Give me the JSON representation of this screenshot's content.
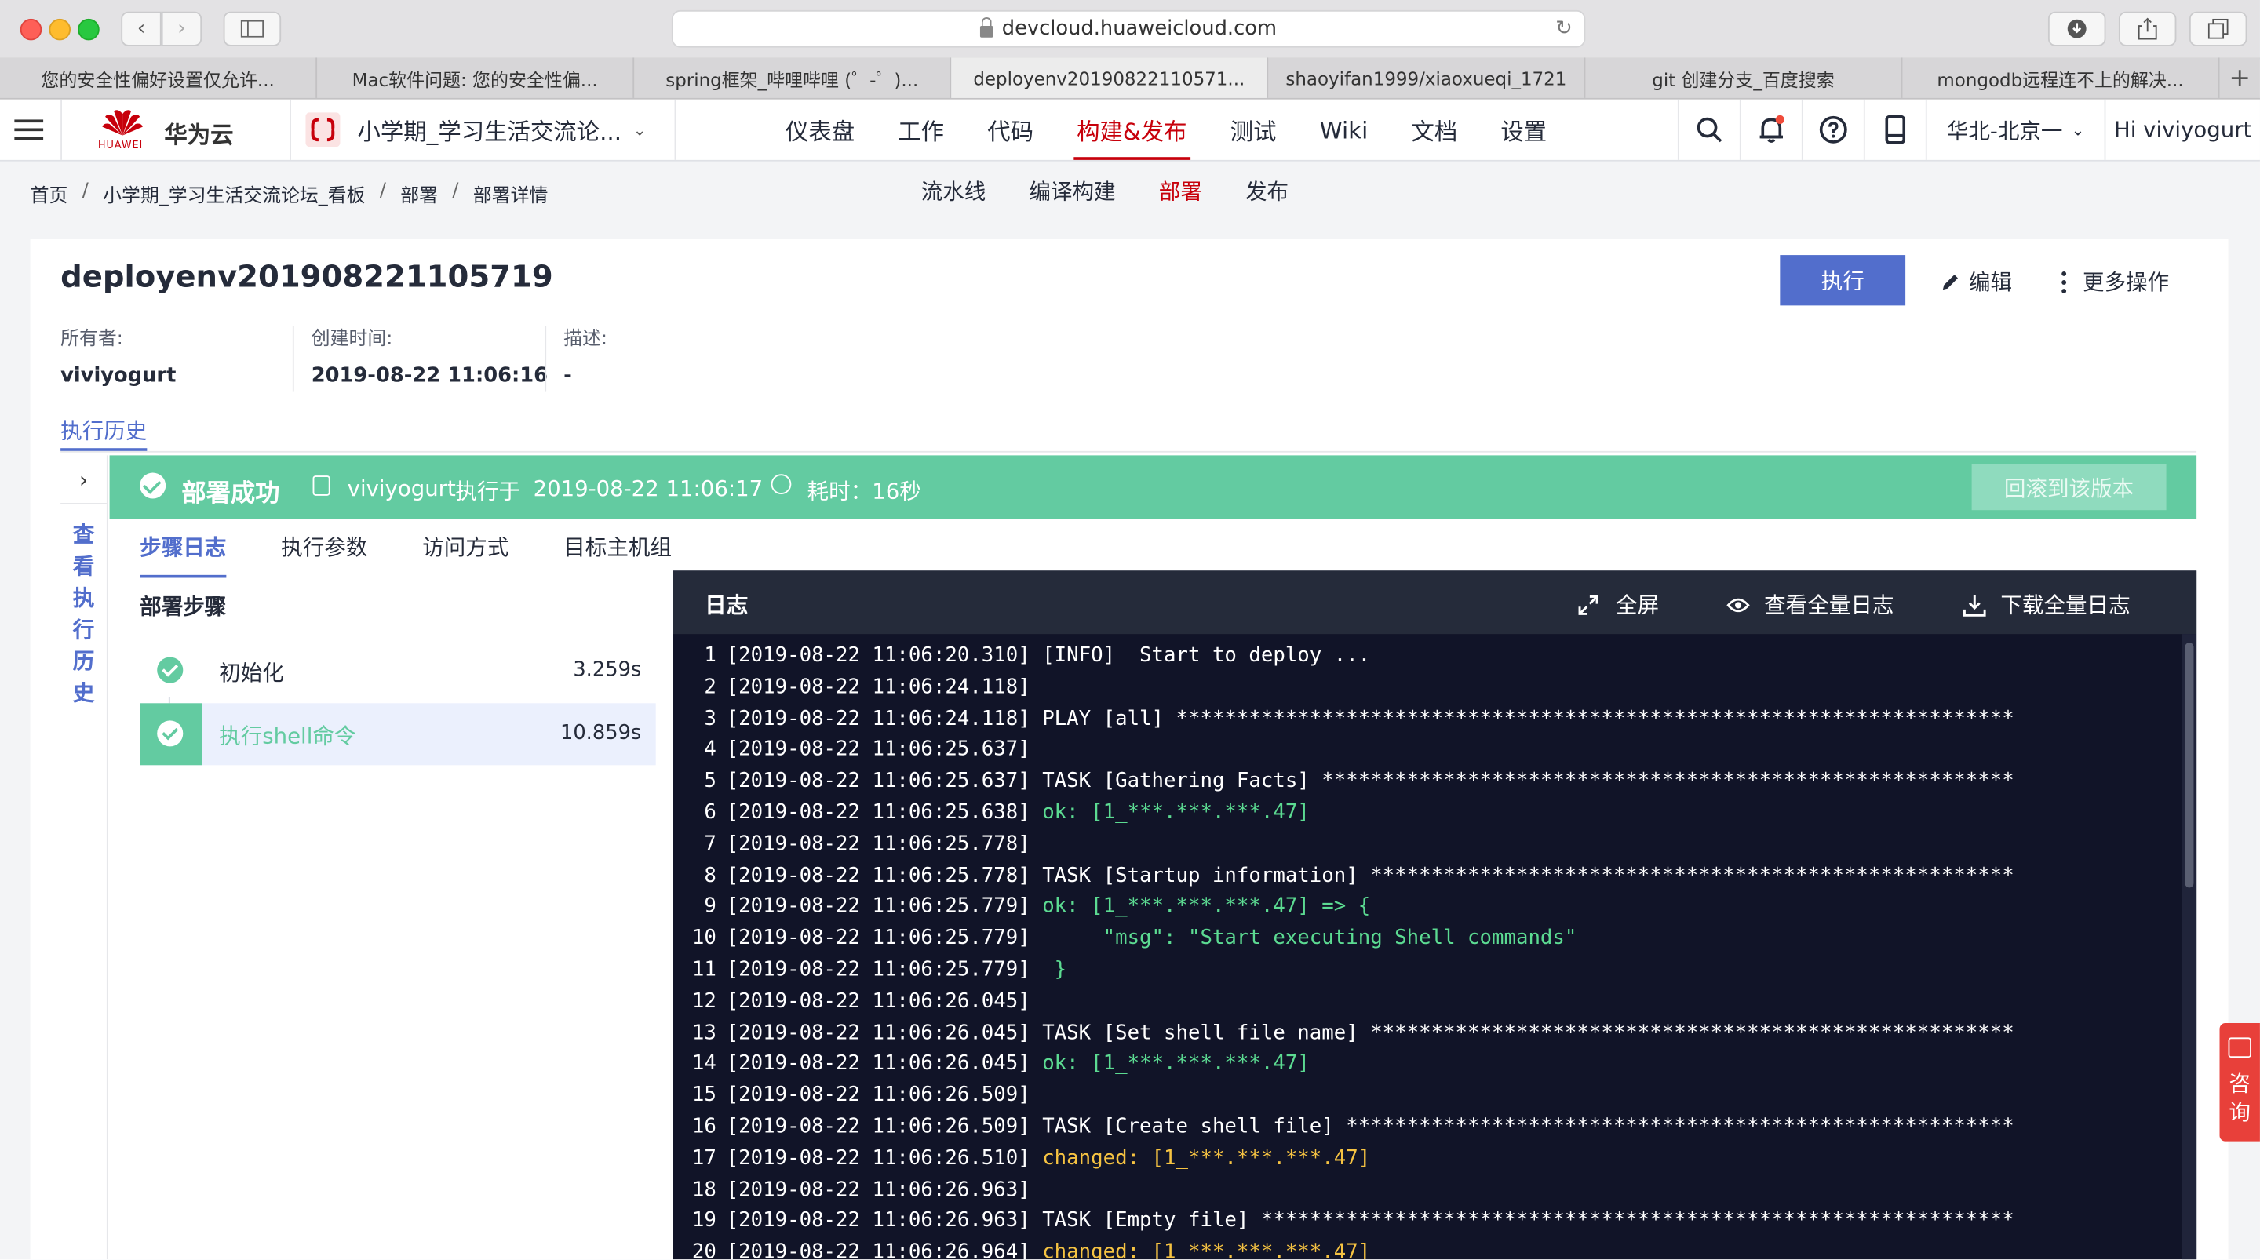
{
  "browser": {
    "url": "devcloud.huaweicloud.com",
    "tabs": [
      "您的安全性偏好设置仅允许...",
      "Mac软件问题: 您的安全性偏...",
      "spring框架_哔哩哔哩 (゜-゜)...",
      "deployenv20190822110571...",
      "shaoyifan1999/xiaoxueqi_1721",
      "git 创建分支_百度搜索",
      "mongodb远程连不上的解决..."
    ]
  },
  "header": {
    "brand": "华为云",
    "brand_small": "HUAWEI",
    "project": "小学期_学习生活交流论...",
    "nav": [
      "仪表盘",
      "工作",
      "代码",
      "构建&发布",
      "测试",
      "Wiki",
      "文档",
      "设置"
    ],
    "region": "华北-北京一",
    "greeting": "Hi viviyogurt"
  },
  "breadcrumb": [
    "首页",
    "小学期_学习生活交流论坛_看板",
    "部署",
    "部署详情"
  ],
  "subnav": [
    "流水线",
    "编译构建",
    "部署",
    "发布"
  ],
  "detail": {
    "title": "deployenv201908221105719",
    "run_label": "执行",
    "edit_label": "编辑",
    "more_label": "更多操作",
    "owner_label": "所有者:",
    "owner": "viviyogurt",
    "created_label": "创建时间:",
    "created": "2019-08-22 11:06:16",
    "desc_label": "描述:",
    "desc": "-",
    "history_tab": "执行历史",
    "strip_label": "查看执行历史"
  },
  "banner": {
    "status": "部署成功",
    "user": "viviyogurt",
    "exec_label": "执行于",
    "exec_time": "2019-08-22 11:06:17",
    "duration": "耗时：16秒",
    "rollback": "回滚到该版本"
  },
  "inner_tabs": [
    "步骤日志",
    "执行参数",
    "访问方式",
    "目标主机组"
  ],
  "steps": {
    "title": "部署步骤",
    "items": [
      {
        "name": "初始化",
        "duration": "3.259s"
      },
      {
        "name": "执行shell命令",
        "duration": "10.859s"
      }
    ]
  },
  "log": {
    "title": "日志",
    "actions": {
      "fullscreen": "全屏",
      "view_all": "查看全量日志",
      "download": "下载全量日志"
    },
    "lines": [
      {
        "n": "1",
        "t": "[2019-08-22 11:06:20.310]",
        "m": " [INFO]  Start to deploy ...",
        "k": "normal"
      },
      {
        "n": "2",
        "t": "[2019-08-22 11:06:24.118]",
        "m": "",
        "k": "normal"
      },
      {
        "n": "3",
        "t": "[2019-08-22 11:06:24.118]",
        "m": " PLAY [all] *********************************************************************",
        "k": "normal"
      },
      {
        "n": "4",
        "t": "[2019-08-22 11:06:25.637]",
        "m": "",
        "k": "normal"
      },
      {
        "n": "5",
        "t": "[2019-08-22 11:06:25.637]",
        "m": " TASK [Gathering Facts] *********************************************************",
        "k": "normal"
      },
      {
        "n": "6",
        "t": "[2019-08-22 11:06:25.638]",
        "m": " ok: [1_***.***.***.47]",
        "k": "ok"
      },
      {
        "n": "7",
        "t": "[2019-08-22 11:06:25.778]",
        "m": "",
        "k": "normal"
      },
      {
        "n": "8",
        "t": "[2019-08-22 11:06:25.778]",
        "m": " TASK [Startup information] *****************************************************",
        "k": "normal"
      },
      {
        "n": "9",
        "t": "[2019-08-22 11:06:25.779]",
        "m": " ok: [1_***.***.***.47] => {",
        "k": "ok"
      },
      {
        "n": "10",
        "t": "[2019-08-22 11:06:25.779]",
        "m": "      \"msg\": \"Start executing Shell commands\"",
        "k": "ok"
      },
      {
        "n": "11",
        "t": "[2019-08-22 11:06:25.779]",
        "m": "  }",
        "k": "ok"
      },
      {
        "n": "12",
        "t": "[2019-08-22 11:06:26.045]",
        "m": "",
        "k": "normal"
      },
      {
        "n": "13",
        "t": "[2019-08-22 11:06:26.045]",
        "m": " TASK [Set shell file name] *****************************************************",
        "k": "normal"
      },
      {
        "n": "14",
        "t": "[2019-08-22 11:06:26.045]",
        "m": " ok: [1_***.***.***.47]",
        "k": "ok"
      },
      {
        "n": "15",
        "t": "[2019-08-22 11:06:26.509]",
        "m": "",
        "k": "normal"
      },
      {
        "n": "16",
        "t": "[2019-08-22 11:06:26.509]",
        "m": " TASK [Create shell file] *******************************************************",
        "k": "normal"
      },
      {
        "n": "17",
        "t": "[2019-08-22 11:06:26.510]",
        "m": " changed: [1_***.***.***.47]",
        "k": "changed"
      },
      {
        "n": "18",
        "t": "[2019-08-22 11:06:26.963]",
        "m": "",
        "k": "normal"
      },
      {
        "n": "19",
        "t": "[2019-08-22 11:06:26.963]",
        "m": " TASK [Empty file] **************************************************************",
        "k": "normal"
      },
      {
        "n": "20",
        "t": "[2019-08-22 11:06:26.964]",
        "m": " changed: [1_***.***.***.47]",
        "k": "changed"
      }
    ]
  },
  "consult": "咨询",
  "colors": {
    "brand_red": "#c7000b",
    "primary_blue": "#526ecc",
    "success_green": "#63cba1",
    "log_bg": "#111428"
  }
}
